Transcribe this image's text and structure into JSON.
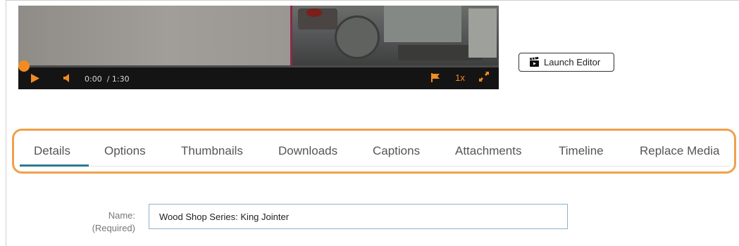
{
  "player": {
    "current_time": "0:00",
    "duration": "/ 1:30",
    "speed": "1x",
    "progress": 0.0,
    "accent_color": "#f28b22",
    "icons": [
      "play-icon",
      "volume-icon",
      "flag-icon",
      "fullscreen-icon"
    ]
  },
  "editor": {
    "launch_label": "Launch Editor",
    "icon": "clapperboard-icon"
  },
  "tabs": {
    "items": [
      {
        "label": "Details"
      },
      {
        "label": "Options"
      },
      {
        "label": "Thumbnails"
      },
      {
        "label": "Downloads"
      },
      {
        "label": "Captions"
      },
      {
        "label": "Attachments"
      },
      {
        "label": "Timeline"
      },
      {
        "label": "Replace Media"
      }
    ],
    "active": "Details",
    "active_color": "#2a7b8c",
    "highlight_color": "#f0a04b"
  },
  "form": {
    "name_label": "Name:",
    "name_required": "(Required)",
    "name_value": "Wood Shop Series: King Jointer"
  }
}
